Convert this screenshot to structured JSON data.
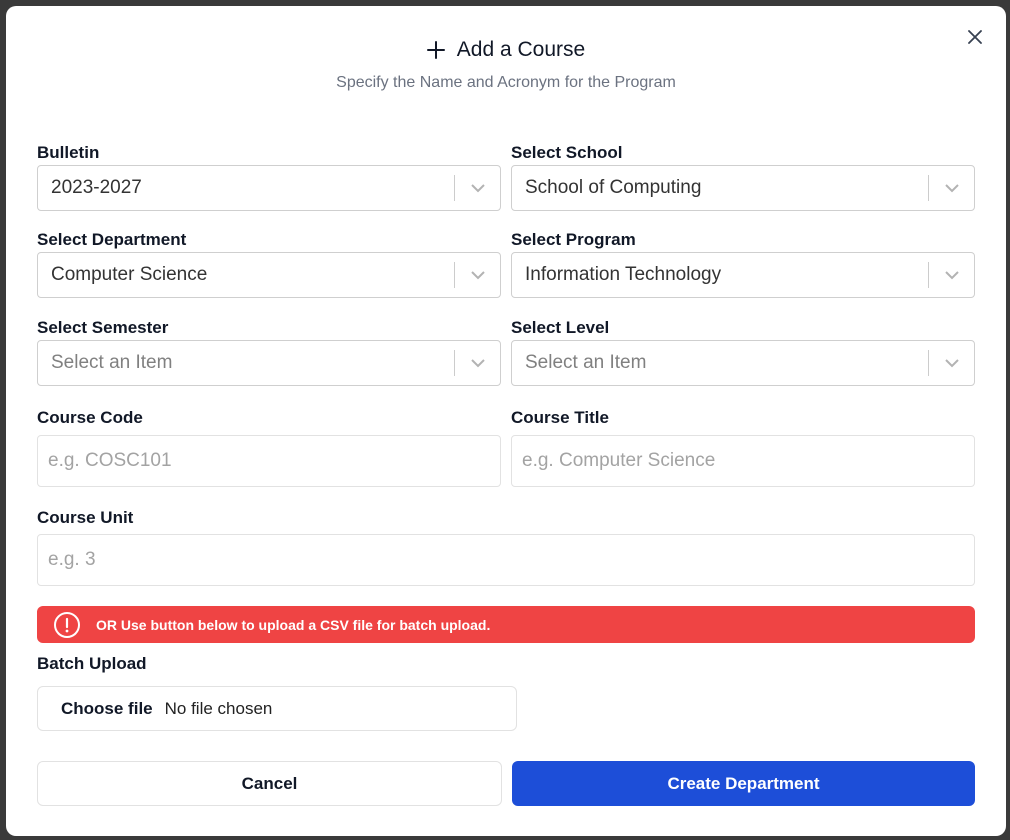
{
  "modal": {
    "title": "Add a Course",
    "subtitle": "Specify the Name and Acronym for the Program"
  },
  "fields": {
    "bulletin": {
      "label": "Bulletin",
      "value": "2023-2027"
    },
    "school": {
      "label": "Select School",
      "value": "School of Computing"
    },
    "department": {
      "label": "Select Department",
      "value": "Computer Science"
    },
    "program": {
      "label": "Select Program",
      "value": "Information Technology"
    },
    "semester": {
      "label": "Select Semester",
      "placeholder": "Select an Item"
    },
    "level": {
      "label": "Select Level",
      "placeholder": "Select an Item"
    },
    "course_code": {
      "label": "Course Code",
      "placeholder": "e.g. COSC101"
    },
    "course_title": {
      "label": "Course Title",
      "placeholder": "e.g. Computer Science"
    },
    "course_unit": {
      "label": "Course Unit",
      "placeholder": "e.g. 3"
    }
  },
  "alert": {
    "text": "OR Use button below to upload a CSV file for batch upload.",
    "color": "#ef4444"
  },
  "batch_upload": {
    "label": "Batch Upload",
    "button_label": "Choose file",
    "status": "No file chosen"
  },
  "actions": {
    "cancel_label": "Cancel",
    "submit_label": "Create Department",
    "primary_color": "#1d4ed8"
  },
  "icons": {
    "title": "plus-icon",
    "close": "close-icon",
    "dropdown": "chevron-down-icon",
    "alert": "info-circle-icon"
  }
}
